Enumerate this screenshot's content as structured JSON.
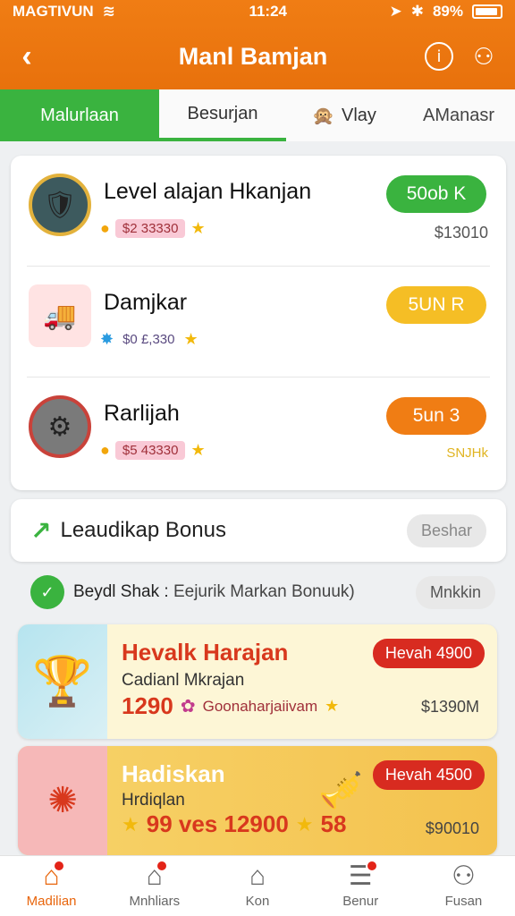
{
  "status": {
    "carrier": "MAGTIVUN",
    "time": "11:24",
    "battery": "89%"
  },
  "header": {
    "title": "Manl Bamjan",
    "back_glyph": "‹"
  },
  "tabs": [
    {
      "label": "Malurlaan"
    },
    {
      "label": "Besurjan"
    },
    {
      "label": "Vlay"
    },
    {
      "label": "AManasr"
    }
  ],
  "levels": [
    {
      "name": "Level alajan Hkanjan",
      "sub": "$2 33330",
      "button": "50ob K",
      "price": "$13010",
      "button_color": "#3ab33f"
    },
    {
      "name": "Damjkar",
      "sub": "$0 £,330",
      "button": "5UN R",
      "price": "",
      "button_color": "#f5be25"
    },
    {
      "name": "Rarlijah",
      "sub": "$5 43330",
      "button": "5un 3",
      "price": "SNJHk",
      "button_color": "#f07d14"
    }
  ],
  "bonus": {
    "label": "Leaudikap Bonus",
    "pill": "Beshar"
  },
  "subrow": {
    "label": "Beydl Shak :",
    "text": "Eejurik  Markan Bonuuk)",
    "pill": "Mnkkin"
  },
  "promos": [
    {
      "title": "Hevalk Harajan",
      "sub": "Cadianl Mkrajan",
      "num": "1290",
      "extra": "Goonaharjaiivam",
      "pill": "Hevah 4900",
      "price": "$1390M"
    },
    {
      "title": "Hadiskan",
      "sub": "Hrdiqlan",
      "num": "99 ves 12900",
      "extra": "58",
      "pill": "Hevah 4500",
      "price": "$90010"
    }
  ],
  "nav": [
    {
      "label": "Madilian"
    },
    {
      "label": "Mnhliars"
    },
    {
      "label": "Kon"
    },
    {
      "label": "Benur"
    },
    {
      "label": "Fusan"
    }
  ],
  "colors": {
    "brand_orange": "#e8710c",
    "accent_green": "#3ab33f",
    "alert_red": "#d82b20"
  }
}
